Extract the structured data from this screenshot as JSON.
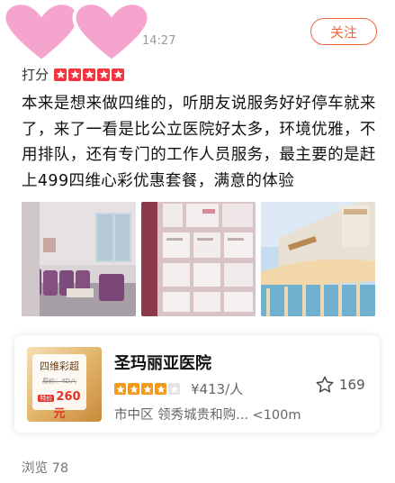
{
  "header": {
    "timestamp": "14:27",
    "follow_label": "关注",
    "heart_color": "#f5a4cd"
  },
  "rating": {
    "label": "打分",
    "stars": 5,
    "color": "#f5353f"
  },
  "review": {
    "text": "本来是想来做四维的，听朋友说服务好好停车就来了，来了一看是比公立医院好太多，环境优雅，不用排队，还有专门的工作人员服务，最主要的是赶上499四维心彩优惠套餐，满意的体验"
  },
  "photos": [
    {
      "subject": "waiting room with purple sofas"
    },
    {
      "subject": "wall of framed certificates"
    },
    {
      "subject": "hospital building exterior"
    }
  ],
  "hospital_card": {
    "thumbnail": {
      "title": "四维彩超",
      "strike_text": "原价：4D八",
      "price_tag": "特价",
      "price": "260元"
    },
    "name": "圣玛丽亚医院",
    "stars_filled": 4,
    "stars_total": 5,
    "price_per_person": "¥413/人",
    "location": "市中区 领秀城贵和购...  <100m",
    "favorites": "169",
    "accent_color": "#f39a1e"
  },
  "footer": {
    "views": "浏览 78"
  }
}
